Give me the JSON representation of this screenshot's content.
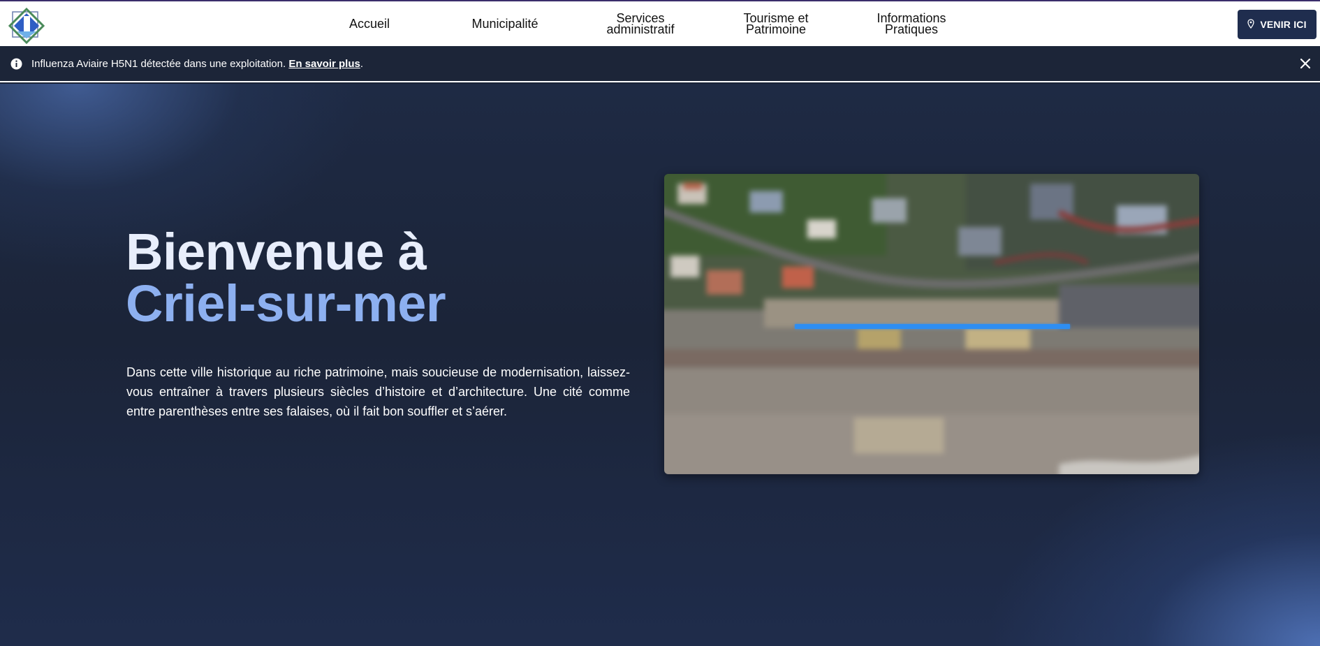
{
  "header": {
    "nav": [
      {
        "line1": "Accueil",
        "line2": ""
      },
      {
        "line1": "Municipalité",
        "line2": ""
      },
      {
        "line1": "Services",
        "line2": "administratif"
      },
      {
        "line1": "Tourisme et",
        "line2": "Patrimoine"
      },
      {
        "line1": "Informations",
        "line2": "Pratiques"
      }
    ],
    "cta_label": "VENIR ICI",
    "cta_icon": "map-pin-icon",
    "logo_icon": "town-logo"
  },
  "alert": {
    "text": "Influenza Aviaire H5N1 détectée dans une exploitation. ",
    "link": "En savoir plus",
    "suffix": ".",
    "icon": "info-icon",
    "close_icon": "close-icon"
  },
  "hero": {
    "title_line1": "Bienvenue à",
    "title_line2": "Criel-sur-mer",
    "description": "Dans cette ville historique au riche patrimoine, mais soucieuse de modernisation, laissez-vous entraîner à travers plusieurs siècles d’histoire et d’architecture. Une cité comme entre parenthèses entre ses falaises, où il fait bon souffler et s’aérer."
  },
  "colors": {
    "header_bg": "#ffffff",
    "cta_bg": "#1f2d4e",
    "alert_bg": "#1c2538",
    "hero_bg": "#1b2438",
    "title_accent": "#8db0f0",
    "loader": "#2e8ef2"
  }
}
